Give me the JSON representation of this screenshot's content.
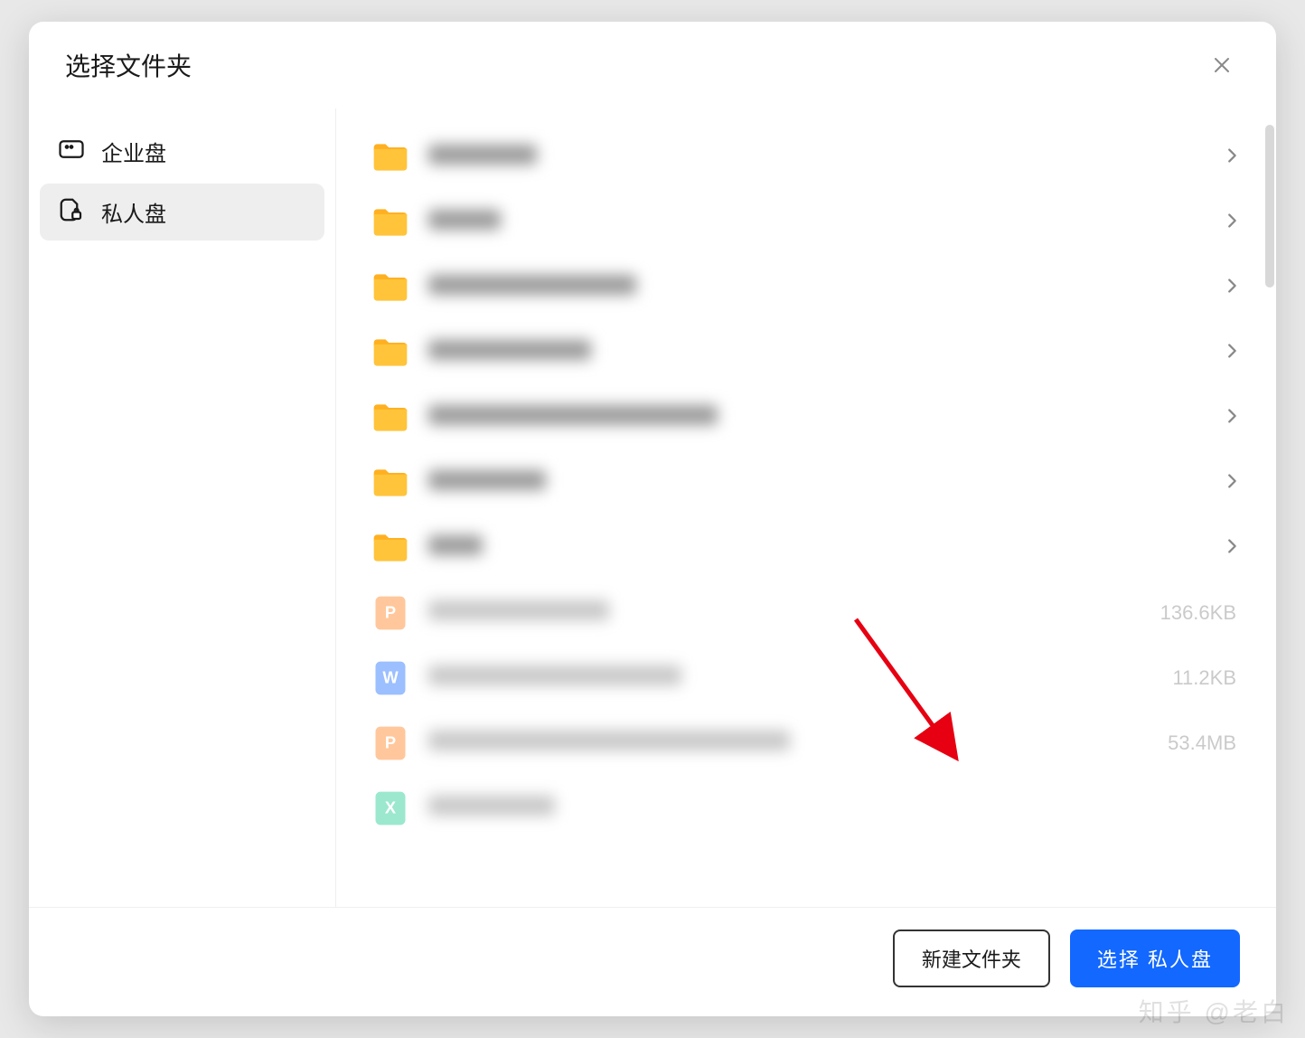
{
  "modal": {
    "title": "选择文件夹"
  },
  "sidebar": {
    "items": [
      {
        "label": "企业盘",
        "iconType": "enterprise",
        "active": false
      },
      {
        "label": "私人盘",
        "iconType": "private",
        "active": true
      }
    ]
  },
  "fileList": {
    "items": [
      {
        "type": "folder",
        "nameWidth": 120,
        "size": ""
      },
      {
        "type": "folder",
        "nameWidth": 80,
        "size": ""
      },
      {
        "type": "folder",
        "nameWidth": 230,
        "size": ""
      },
      {
        "type": "folder",
        "nameWidth": 180,
        "size": ""
      },
      {
        "type": "folder",
        "nameWidth": 320,
        "size": ""
      },
      {
        "type": "folder",
        "nameWidth": 130,
        "size": ""
      },
      {
        "type": "folder",
        "nameWidth": 60,
        "size": ""
      },
      {
        "type": "ppt",
        "nameWidth": 200,
        "size": "136.6KB"
      },
      {
        "type": "doc",
        "nameWidth": 280,
        "size": "11.2KB"
      },
      {
        "type": "ppt",
        "nameWidth": 400,
        "size": "53.4MB"
      },
      {
        "type": "xls",
        "nameWidth": 140,
        "size": ""
      }
    ]
  },
  "footer": {
    "newFolderLabel": "新建文件夹",
    "selectLabel": "选择 私人盘"
  },
  "watermark": "知乎 @老白",
  "colors": {
    "primary": "#1268ff",
    "folder": "#ffc43a",
    "ppt": "#ff9b4a",
    "doc": "#4a8cff",
    "xls": "#4ad6a8"
  }
}
